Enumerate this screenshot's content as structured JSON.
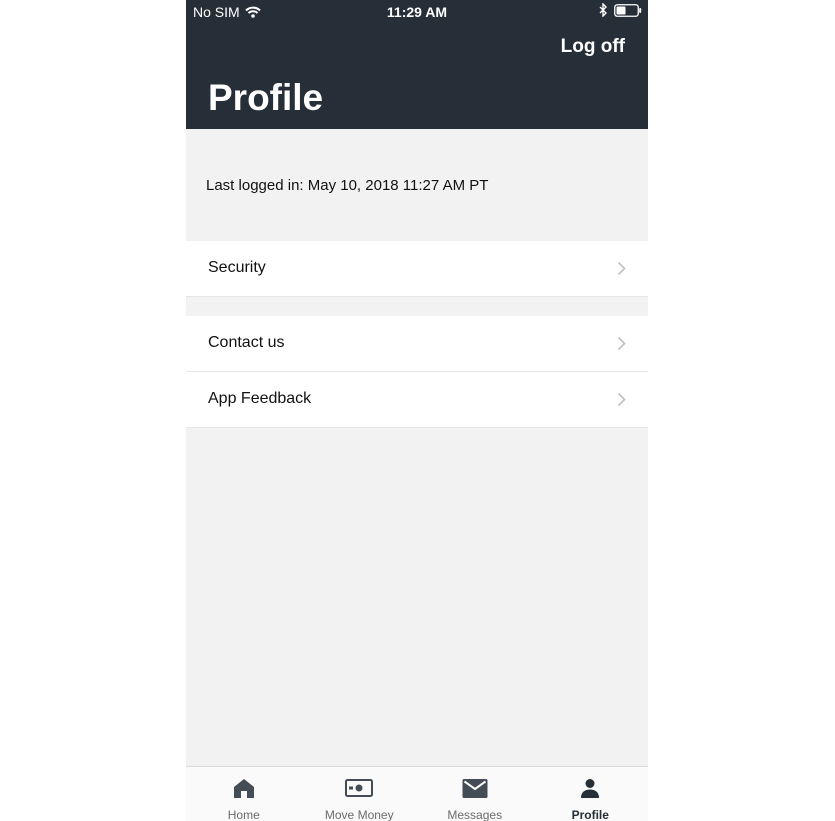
{
  "status_bar": {
    "carrier": "No SIM",
    "time": "11:29 AM"
  },
  "header": {
    "logoff_label": "Log off",
    "title": "Profile"
  },
  "last_login": "Last logged in: May 10, 2018 11:27 AM PT",
  "sections": [
    {
      "items": [
        {
          "label": "Security"
        }
      ]
    },
    {
      "items": [
        {
          "label": "Contact us"
        },
        {
          "label": "App Feedback"
        }
      ]
    }
  ],
  "tabbar": {
    "active": "Profile",
    "tabs": [
      {
        "label": "Home",
        "icon": "home-icon"
      },
      {
        "label": "Move Money",
        "icon": "money-icon"
      },
      {
        "label": "Messages",
        "icon": "envelope-icon"
      },
      {
        "label": "Profile",
        "icon": "person-icon"
      }
    ]
  },
  "colors": {
    "header_bg": "#262e38",
    "background": "#f2f2f2",
    "tab_icon": "#444c56"
  }
}
